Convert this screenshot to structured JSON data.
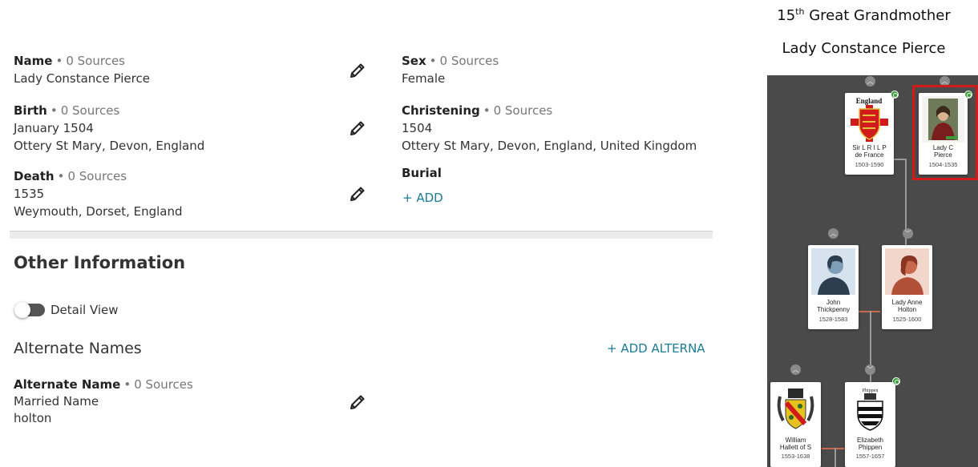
{
  "header": {
    "relationship_prefix": "15",
    "relationship_sup": "th",
    "relationship_suffix": " Great Grandmother",
    "person_name": "Lady Constance Pierce"
  },
  "facts": {
    "source_sep": "•",
    "name": {
      "title": "Name",
      "sources": "0 Sources",
      "lines": [
        "Lady Constance Pierce"
      ]
    },
    "birth": {
      "title": "Birth",
      "sources": "0 Sources",
      "lines": [
        "January 1504",
        "Ottery St Mary, Devon, England"
      ]
    },
    "death": {
      "title": "Death",
      "sources": "0 Sources",
      "lines": [
        "1535",
        "Weymouth, Dorset, England"
      ]
    },
    "sex": {
      "title": "Sex",
      "sources": "0 Sources",
      "lines": [
        "Female"
      ]
    },
    "christening": {
      "title": "Christening",
      "sources": "0 Sources",
      "lines": [
        "1504",
        "Ottery St Mary, Devon, England, United Kingdom"
      ]
    },
    "burial": {
      "title": "Burial",
      "add_label": "+  ADD"
    }
  },
  "other_info": {
    "title": "Other Information",
    "detail_view_label": "Detail View",
    "detail_view_on": false,
    "alternate_names_title": "Alternate Names",
    "add_alternate_label": "+  ADD ALTERNA",
    "alternate": {
      "title": "Alternate Name",
      "sources": "0 Sources",
      "lines": [
        "Married Name",
        "holton"
      ]
    }
  },
  "tree": {
    "cards": {
      "sir": {
        "name": [
          "Sir L R I L P",
          "de France"
        ],
        "dates": "1503-1590",
        "crest_text": "England"
      },
      "lady": {
        "name": [
          "Lady C",
          "Pierce"
        ],
        "dates": "1504-1535"
      },
      "john": {
        "name": [
          "John",
          "Thickpenny"
        ],
        "dates": "1528-1583"
      },
      "anne": {
        "name": [
          "Lady Anne",
          "Holton"
        ],
        "dates": "1525-1600"
      },
      "william": {
        "name": [
          "William",
          "Hallett of S"
        ],
        "dates": "1553-1638"
      },
      "elizabeth": {
        "name": [
          "Elizabeth",
          "Phippen"
        ],
        "dates": "1557-1657",
        "crest_text": "Phippen"
      }
    }
  },
  "colors": {
    "accent_link": "#1a7c95",
    "tree_bg": "#4a4a4a",
    "selected_border": "#d11a1a",
    "hint_green": "#39a03a",
    "female_avatar": "#c8684f",
    "male_avatar": "#7f9fb8"
  },
  "icons": {
    "edit": "pencil-icon",
    "chevron_up": "chevron-up-icon",
    "chevron_down": "chevron-down-icon",
    "hint": "hint-leaf-icon"
  }
}
